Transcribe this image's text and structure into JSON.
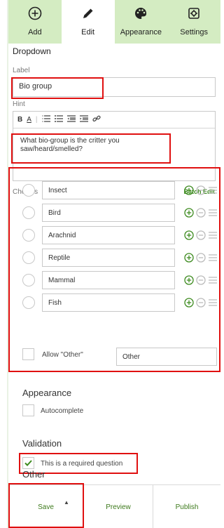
{
  "toolbar": {
    "add": "Add",
    "edit": "Edit",
    "appearance": "Appearance",
    "settings": "Settings"
  },
  "form": {
    "section_title": "Dropdown",
    "label_title": "Label",
    "label_value": "Bio group",
    "hint_title": "Hint",
    "hint_text": "What bio-group is the critter you saw/heard/smelled?",
    "editor_buttons": [
      "B",
      "A",
      "list-ordered-icon",
      "list-bullet-icon",
      "outdent-icon",
      "indent-icon",
      "link-icon"
    ]
  },
  "choices": {
    "title": "Choices",
    "batch_edit": "Batch Edit",
    "items": [
      "Insect",
      "Bird",
      "Arachnid",
      "Reptile",
      "Mammal",
      "Fish"
    ],
    "allow_other_label": "Allow \"Other\"",
    "other_value": "Other"
  },
  "appearance": {
    "title": "Appearance",
    "autocomplete_label": "Autocomplete",
    "autocomplete_checked": false
  },
  "validation": {
    "title": "Validation",
    "required_label": "This is a required question",
    "required_checked": true
  },
  "other_section": {
    "title": "Other"
  },
  "footer": {
    "save": "Save",
    "preview": "Preview",
    "publish": "Publish"
  },
  "colors": {
    "toolbar_green": "#d4ecc2",
    "accent_green": "#3c8a1e",
    "highlight_red": "#e01010"
  }
}
